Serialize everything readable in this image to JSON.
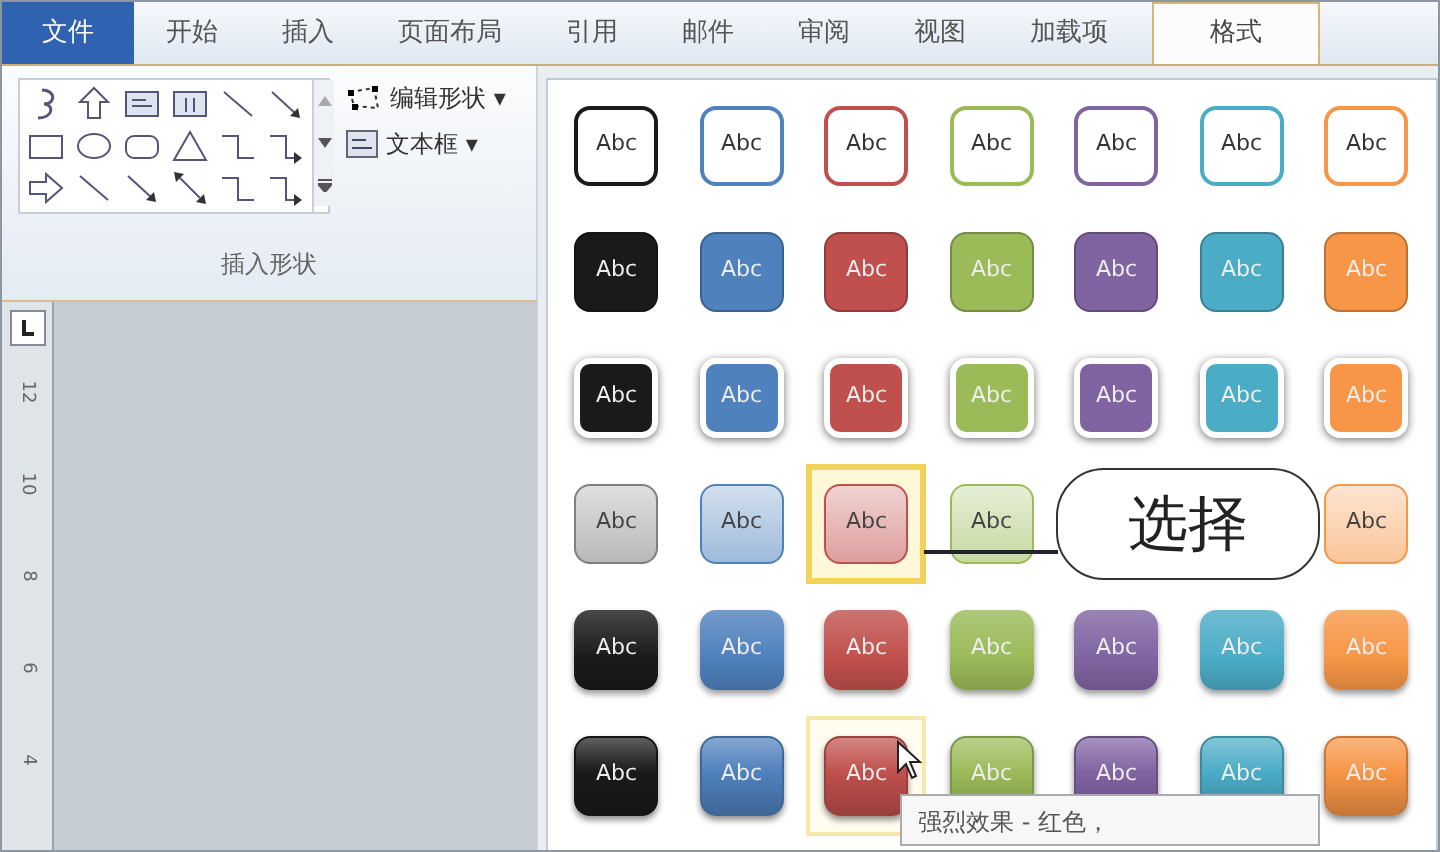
{
  "tabs": [
    {
      "label": "文件",
      "kind": "file",
      "selected": false
    },
    {
      "label": "开始",
      "kind": "tab",
      "selected": false
    },
    {
      "label": "插入",
      "kind": "tab",
      "selected": false
    },
    {
      "label": "页面布局",
      "kind": "tab",
      "selected": false
    },
    {
      "label": "引用",
      "kind": "tab",
      "selected": false
    },
    {
      "label": "邮件",
      "kind": "tab",
      "selected": false
    },
    {
      "label": "审阅",
      "kind": "tab",
      "selected": false
    },
    {
      "label": "视图",
      "kind": "tab",
      "selected": false
    },
    {
      "label": "加载项",
      "kind": "tab",
      "selected": false
    },
    {
      "label": "格式",
      "kind": "tab",
      "selected": true
    }
  ],
  "ribbon_group": {
    "commands": [
      {
        "label": "编辑形状",
        "caret": "▾",
        "kind": "edit"
      },
      {
        "label": "文本框",
        "caret": "▾",
        "kind": "textbox"
      }
    ],
    "label": "插入形状"
  },
  "ruler": {
    "labels": [
      "12",
      "10",
      "8",
      "6",
      "4"
    ]
  },
  "style_gallery": {
    "rows": [
      {
        "kind": "outline",
        "cells": [
          {
            "label": "Abc",
            "color": "#1a1a1a",
            "selected": false,
            "hovered": false
          },
          {
            "label": "Abc",
            "color": "#4f81bd",
            "selected": false,
            "hovered": false
          },
          {
            "label": "Abc",
            "color": "#c0504d",
            "selected": false,
            "hovered": false
          },
          {
            "label": "Abc",
            "color": "#9bbb59",
            "selected": false,
            "hovered": false
          },
          {
            "label": "Abc",
            "color": "#8064a2",
            "selected": false,
            "hovered": false
          },
          {
            "label": "Abc",
            "color": "#4bacc6",
            "selected": false,
            "hovered": false
          },
          {
            "label": "Abc",
            "color": "#f79646",
            "selected": false,
            "hovered": false
          }
        ]
      },
      {
        "kind": "solid",
        "cells": [
          {
            "label": "Abc",
            "color": "#1a1a1a",
            "selected": false,
            "hovered": false
          },
          {
            "label": "Abc",
            "color": "#4f81bd",
            "selected": false,
            "hovered": false
          },
          {
            "label": "Abc",
            "color": "#c0504d",
            "selected": false,
            "hovered": false
          },
          {
            "label": "Abc",
            "color": "#9bbb59",
            "selected": false,
            "hovered": false
          },
          {
            "label": "Abc",
            "color": "#8064a2",
            "selected": false,
            "hovered": false
          },
          {
            "label": "Abc",
            "color": "#4bacc6",
            "selected": false,
            "hovered": false
          },
          {
            "label": "Abc",
            "color": "#f79646",
            "selected": false,
            "hovered": false
          }
        ]
      },
      {
        "kind": "raised",
        "cells": [
          {
            "label": "Abc",
            "color": "#1a1a1a",
            "selected": false,
            "hovered": false
          },
          {
            "label": "Abc",
            "color": "#4f81bd",
            "selected": false,
            "hovered": false
          },
          {
            "label": "Abc",
            "color": "#c0504d",
            "selected": false,
            "hovered": false
          },
          {
            "label": "Abc",
            "color": "#9bbb59",
            "selected": false,
            "hovered": false
          },
          {
            "label": "Abc",
            "color": "#8064a2",
            "selected": false,
            "hovered": false
          },
          {
            "label": "Abc",
            "color": "#4bacc6",
            "selected": false,
            "hovered": false
          },
          {
            "label": "Abc",
            "color": "#f79646",
            "selected": false,
            "hovered": false
          }
        ]
      },
      {
        "kind": "subtle",
        "cells": [
          {
            "label": "Abc",
            "color": "#7f7f7f",
            "selected": false,
            "hovered": false
          },
          {
            "label": "Abc",
            "color": "#4f81bd",
            "selected": false,
            "hovered": false
          },
          {
            "label": "Abc",
            "color": "#c0504d",
            "selected": true,
            "hovered": false
          },
          {
            "label": "Abc",
            "color": "#9bbb59",
            "selected": false,
            "hovered": false
          },
          "",
          "",
          {
            "label": "Abc",
            "color": "#f79646",
            "selected": false,
            "hovered": false
          }
        ]
      },
      {
        "kind": "moderate",
        "cells": [
          {
            "label": "Abc",
            "color": "#1a1a1a",
            "selected": false,
            "hovered": false
          },
          {
            "label": "Abc",
            "color": "#4f81bd",
            "selected": false,
            "hovered": false
          },
          {
            "label": "Abc",
            "color": "#c0504d",
            "selected": false,
            "hovered": false
          },
          {
            "label": "Abc",
            "color": "#9bbb59",
            "selected": false,
            "hovered": false
          },
          {
            "label": "Abc",
            "color": "#8064a2",
            "selected": false,
            "hovered": false
          },
          {
            "label": "Abc",
            "color": "#4bacc6",
            "selected": false,
            "hovered": false
          },
          {
            "label": "Abc",
            "color": "#f79646",
            "selected": false,
            "hovered": false
          }
        ]
      },
      {
        "kind": "intense",
        "cells": [
          {
            "label": "Abc",
            "color": "#1a1a1a",
            "selected": false,
            "hovered": false
          },
          {
            "label": "Abc",
            "color": "#4f81bd",
            "selected": false,
            "hovered": false
          },
          {
            "label": "Abc",
            "color": "#c0504d",
            "selected": false,
            "hovered": true
          },
          {
            "label": "Abc",
            "color": "#9bbb59",
            "selected": false,
            "hovered": false
          },
          {
            "label": "Abc",
            "color": "#8064a2",
            "selected": false,
            "hovered": false
          },
          {
            "label": "Abc",
            "color": "#4bacc6",
            "selected": false,
            "hovered": false
          },
          {
            "label": "Abc",
            "color": "#f79646",
            "selected": false,
            "hovered": false
          }
        ]
      }
    ]
  },
  "callout": {
    "text": "选择"
  },
  "tooltip": {
    "text": "强烈效果 - 红色，"
  }
}
